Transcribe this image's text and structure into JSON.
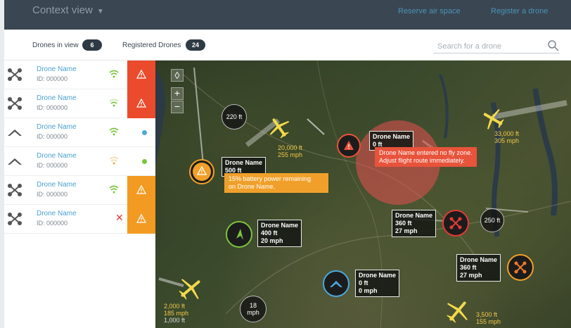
{
  "topbar": {
    "view_title": "Context view",
    "reserve_link": "Reserve air space",
    "register_link": "Register a drone"
  },
  "subbar": {
    "drones_in_view_label": "Drones in view",
    "drones_in_view_count": "6",
    "registered_label": "Registered Drones",
    "registered_count": "24",
    "search_placeholder": "Search for a drone"
  },
  "drone_list": [
    {
      "name": "Drone Name",
      "id": "ID: 000000",
      "type": "quadcopter",
      "signal": "strong",
      "status": "warning-red"
    },
    {
      "name": "Drone Name",
      "id": "ID: 000000",
      "type": "quadcopter",
      "signal": "medium",
      "status": "warning-red"
    },
    {
      "name": "Drone Name",
      "id": "ID: 000000",
      "type": "fixed-wing",
      "signal": "strong",
      "status": "dot-blue"
    },
    {
      "name": "Drone Name",
      "id": "ID: 000000",
      "type": "fixed-wing",
      "signal": "weak",
      "status": "dot-green"
    },
    {
      "name": "Drone Name",
      "id": "ID: 000000",
      "type": "quadcopter",
      "signal": "strong",
      "status": "warning-orange"
    },
    {
      "name": "Drone Name",
      "id": "ID: 000000",
      "type": "quadcopter",
      "signal": "none",
      "status": "warning-orange"
    }
  ],
  "map": {
    "labels": {
      "l220": "220 ft",
      "l250": "250 ft",
      "l18": "18",
      "l18b": "mph",
      "plane1_alt": "20,000 ft",
      "plane1_spd": "255 mph",
      "plane2_alt": "33,000 ft",
      "plane2_spd": "305 mph",
      "plane3_alt": "2,000 ft",
      "plane3_spd": "185 mph",
      "plane3_extra": "1,000 ft",
      "plane4_alt": "3,500 ft",
      "plane4_spd": "155 mph"
    },
    "drone_labels": {
      "a_name": "Drone Name",
      "a_alt": "0 ft",
      "b_name": "Drone Name",
      "b_alt": "500 ft",
      "c_name": "Drone Name",
      "c_alt": "400 ft",
      "c_spd": "20 mph",
      "d_name": "Drone Name",
      "d_alt": "360 ft",
      "d_spd": "27 mph",
      "e_name": "Drone Name",
      "e_alt": "360 ft",
      "e_spd": "27 mph",
      "f_name": "Drone Name",
      "f_alt": "0 ft",
      "f_spd": "0 mph"
    },
    "alerts": {
      "nofly_line1": "Drone Name entered no fly zone.",
      "nofly_line2": "Adjust flight route immediately.",
      "battery_line1": "15% battery power remaining",
      "battery_line2": "on Drone Name."
    },
    "controls": {
      "zoom_in": "+",
      "zoom_out": "−"
    }
  },
  "colors": {
    "alert_red": "#ea4b2c",
    "alert_orange": "#f39a22",
    "accent_blue": "#4aa1cf",
    "plane_yellow": "#f2d94b"
  }
}
